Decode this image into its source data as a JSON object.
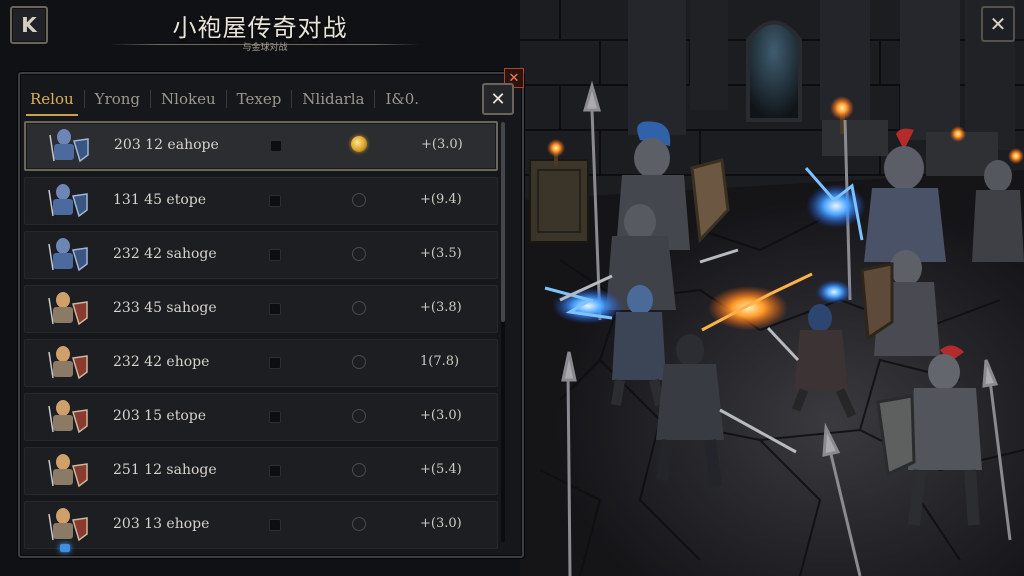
{
  "header": {
    "back_label": "K",
    "title": "小袍屋传奇对战",
    "subtitle": "与金球对战",
    "close_label": "✕"
  },
  "panel": {
    "close_small_label": "✕",
    "close_label": "✕",
    "tabs": [
      {
        "label": "Relou",
        "active": true
      },
      {
        "label": "Yrong"
      },
      {
        "label": "Nlokeu"
      },
      {
        "label": "Texep"
      },
      {
        "label": "Nlidarla"
      },
      {
        "label": "I&0."
      }
    ],
    "rows": [
      {
        "name": "203 12  eahope",
        "marker": "medal",
        "score": "+(3.0)",
        "selected": true,
        "avatar": "blue-knight-icon"
      },
      {
        "name": "131 45  etope",
        "marker": "radio",
        "score": "+(9.4)",
        "avatar": "blue-knight-icon"
      },
      {
        "name": "232 42  sahoge",
        "marker": "radio",
        "score": "+(3.5)",
        "avatar": "blue-knight-icon"
      },
      {
        "name": "233 45  sahoge",
        "marker": "radio",
        "score": "+(3.8)",
        "avatar": "gold-knight-icon"
      },
      {
        "name": "232 42  ehope",
        "marker": "radio",
        "score": "1(7.8)",
        "avatar": "gold-knight-icon"
      },
      {
        "name": "203 15  etope",
        "marker": "radio",
        "score": "+(3.0)",
        "avatar": "gold-knight-icon"
      },
      {
        "name": "251 12  sahoge",
        "marker": "radio",
        "score": "+(5.4)",
        "avatar": "gold-knight-icon"
      },
      {
        "name": "203 13  ehope",
        "marker": "radio",
        "score": "+(3.0)",
        "avatar": "gold-knight-icon"
      }
    ]
  },
  "colors": {
    "accent_gold": "#d9b15a",
    "panel_bg": "#15171b",
    "magic_blue": "#4aa3ff",
    "fire_orange": "#ff8a2a"
  }
}
